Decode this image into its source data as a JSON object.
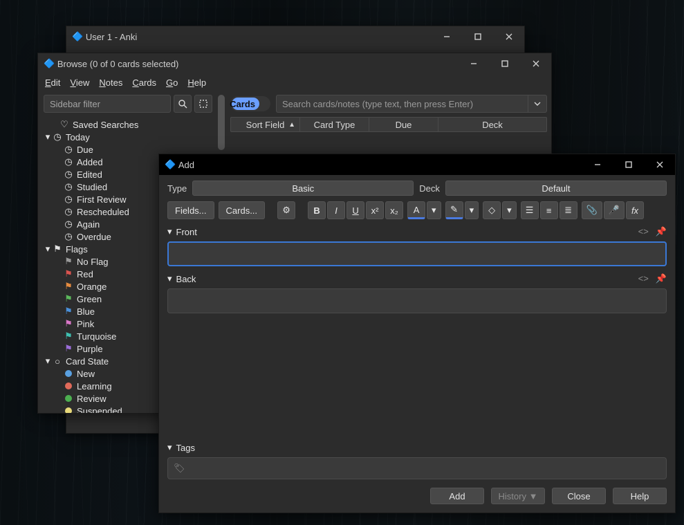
{
  "main_window": {
    "title": "User 1 - Anki"
  },
  "browse_window": {
    "title": "Browse (0 of 0 cards selected)",
    "menu": {
      "edit": "Edit",
      "view": "View",
      "notes": "Notes",
      "cards": "Cards",
      "go": "Go",
      "help": "Help"
    },
    "sidebar_filter_placeholder": "Sidebar filter",
    "toggle_label": "Cards",
    "search_placeholder": "Search cards/notes (type text, then press Enter)",
    "columns": {
      "sort_field": "Sort Field",
      "card_type": "Card Type",
      "due": "Due",
      "deck": "Deck"
    },
    "tree": {
      "saved_searches": "Saved Searches",
      "today": "Today",
      "today_children": {
        "due": "Due",
        "added": "Added",
        "edited": "Edited",
        "studied": "Studied",
        "first_review": "First Review",
        "rescheduled": "Rescheduled",
        "again": "Again",
        "overdue": "Overdue"
      },
      "flags": "Flags",
      "flag_children": {
        "no_flag": "No Flag",
        "red": "Red",
        "orange": "Orange",
        "green": "Green",
        "blue": "Blue",
        "pink": "Pink",
        "turquoise": "Turquoise",
        "purple": "Purple"
      },
      "flag_colors": {
        "no_flag": "#9a9a9a",
        "red": "#d9534f",
        "orange": "#e58b3f",
        "green": "#5cb85c",
        "blue": "#4a90d9",
        "pink": "#d977c7",
        "turquoise": "#3fbfb0",
        "purple": "#9a6dd7"
      },
      "card_state": "Card State",
      "state_children": {
        "new": "New",
        "learning": "Learning",
        "review": "Review",
        "suspended": "Suspended"
      },
      "state_colors": {
        "new": "#5aa0e0",
        "learning": "#e06a5a",
        "review": "#4caf50",
        "suspended": "#e8d97a"
      }
    }
  },
  "add_window": {
    "title": "Add",
    "type_label": "Type",
    "type_value": "Basic",
    "deck_label": "Deck",
    "deck_value": "Default",
    "fields_btn": "Fields...",
    "cards_btn": "Cards...",
    "front_label": "Front",
    "back_label": "Back",
    "tags_label": "Tags",
    "footer": {
      "add": "Add",
      "history": "History ▼",
      "close": "Close",
      "help": "Help"
    }
  }
}
